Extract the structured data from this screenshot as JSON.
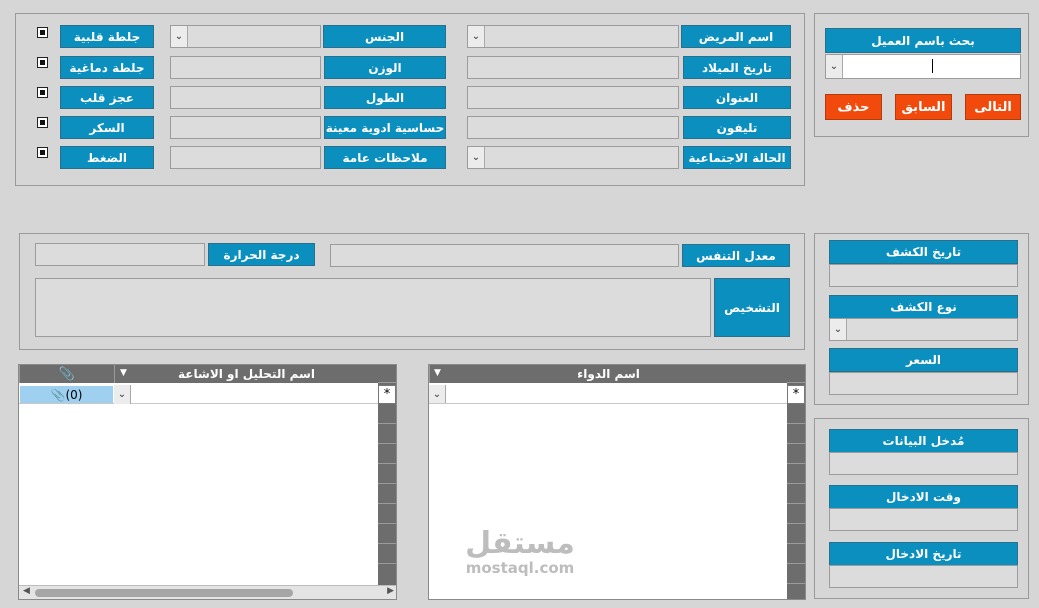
{
  "patient_form": {
    "col1": [
      {
        "label": "اسم المريض",
        "type": "combo"
      },
      {
        "label": "تاريخ الميلاد",
        "type": "text"
      },
      {
        "label": "العنوان",
        "type": "text"
      },
      {
        "label": "تليفون",
        "type": "text"
      },
      {
        "label": "الحالة الاجتماعية",
        "type": "combo"
      }
    ],
    "col2": [
      {
        "label": "الجنس",
        "type": "combo"
      },
      {
        "label": "الوزن",
        "type": "text"
      },
      {
        "label": "الطول",
        "type": "text"
      },
      {
        "label": "حساسية ادوية معينة",
        "type": "text"
      },
      {
        "label": "ملاحظات عامة",
        "type": "text"
      }
    ],
    "col3": [
      {
        "label": "جلطة قلبية",
        "checked": true
      },
      {
        "label": "جلطة دماغية",
        "checked": true
      },
      {
        "label": "عجز قلب",
        "checked": true
      },
      {
        "label": "السكر",
        "checked": true
      },
      {
        "label": "الضغط",
        "checked": true
      }
    ]
  },
  "search": {
    "title": "بحث باسم العميل",
    "value": "",
    "next_label": "التالى",
    "prev_label": "السابق",
    "delete_label": "حذف"
  },
  "exam": {
    "breath_rate_label": "معدل التنفس",
    "temperature_label": "درجة الحرارة",
    "diagnosis_label": "التشخيص"
  },
  "visit": {
    "date_label": "تاريخ الكشف",
    "type_label": "نوع الكشف",
    "price_label": "السعر"
  },
  "entry": {
    "user_label": "مُدخل البيانات",
    "time_label": "وقت الادخال",
    "date_label": "تاريخ الادخال"
  },
  "tests_grid": {
    "column": "اسم التحليل او الاشاعة",
    "attachment_value": "(0)",
    "new_row_marker": "*"
  },
  "meds_grid": {
    "column": "اسم الدواء",
    "new_row_marker": "*"
  },
  "watermark": {
    "arabic": "مستقل",
    "latin": "mostaql.com"
  },
  "colors": {
    "label_blue": "#0a8fbe",
    "button_red": "#f24a0c",
    "grid_header": "#6d6d6d",
    "background": "#d6d6d6"
  }
}
